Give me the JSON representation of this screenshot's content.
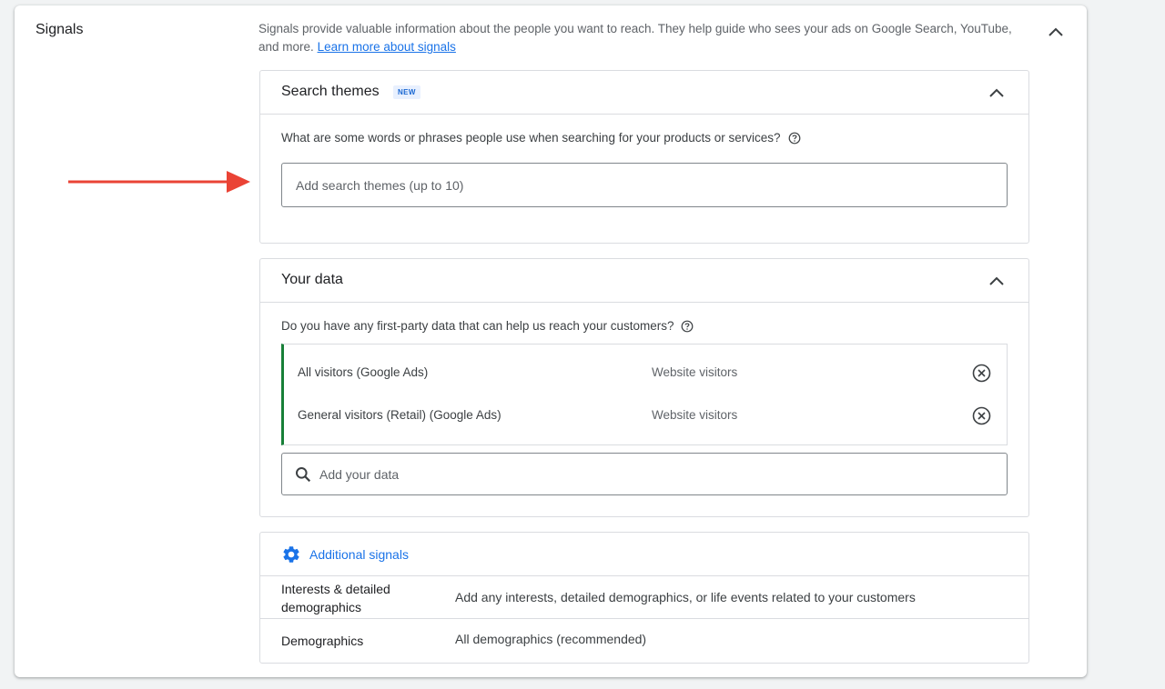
{
  "section": {
    "title": "Signals",
    "description": "Signals provide valuable information about the people you want to reach. They help guide who sees your ads on Google Search, YouTube, and more.",
    "learn_more": "Learn more about signals"
  },
  "search_themes": {
    "title": "Search themes",
    "badge": "NEW",
    "question": "What are some words or phrases people use when searching for your products or services?",
    "input_placeholder": "Add search themes (up to 10)",
    "input_value": ""
  },
  "your_data": {
    "title": "Your data",
    "question": "Do you have any first-party data that can help us reach your customers?",
    "items": [
      {
        "name": "All visitors (Google Ads)",
        "type": "Website visitors"
      },
      {
        "name": "General visitors (Retail) (Google Ads)",
        "type": "Website visitors"
      }
    ],
    "search_placeholder": "Add your data",
    "search_value": ""
  },
  "additional_signals": {
    "link_label": "Additional signals",
    "rows": [
      {
        "label": "Interests & detailed demographics",
        "value": "Add any interests, detailed demographics, or life events related to your customers"
      },
      {
        "label": "Demographics",
        "value": "All demographics (recommended)"
      }
    ]
  },
  "colors": {
    "accent": "#1a73e8",
    "annotation_arrow": "#ea4335",
    "list_indicator": "#188038"
  },
  "icons": {
    "collapse": "chevron-up-icon",
    "help": "help-circle-icon",
    "remove": "cancel-circle-icon",
    "search": "search-icon",
    "settings": "gear-icon"
  }
}
